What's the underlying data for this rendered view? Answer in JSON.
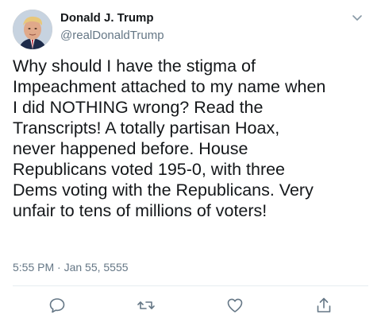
{
  "tweet": {
    "display_name": "Donald J. Trump",
    "handle": "@realDonaldTrump",
    "text": "Why should I have the stigma of\nImpeachment attached to my name when\nI did NOTHING wrong? Read the\nTranscripts! A totally partisan Hoax,\nnever happened before. House\nRepublicans voted 195-0, with three\nDems voting with the Republicans. Very\nunfair to tens of millions of voters!",
    "timestamp": "5:55 PM · Jan 55, 5555"
  },
  "icons": {
    "more": "chevron-down-icon",
    "reply": "reply-icon",
    "retweet": "retweet-icon",
    "like": "heart-icon",
    "share": "share-icon"
  },
  "colors": {
    "text": "#14171a",
    "secondary": "#657786",
    "icon": "#657786",
    "divider": "#e6ecf0"
  }
}
